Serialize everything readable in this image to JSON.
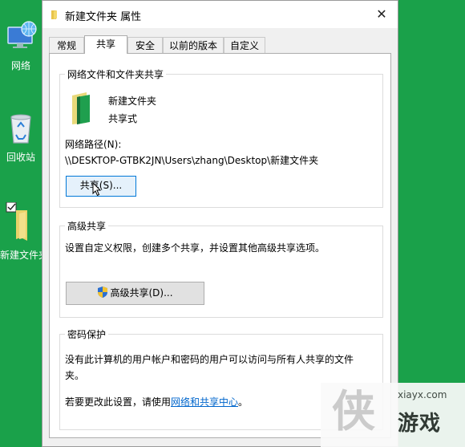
{
  "desktop": {
    "icons": [
      {
        "label": "网络",
        "icon": "network-icon"
      },
      {
        "label": "回收站",
        "icon": "recycle-bin-icon"
      },
      {
        "label": "新建文件夹",
        "icon": "folder-icon"
      }
    ]
  },
  "dialog": {
    "title": "新建文件夹 属性",
    "close_glyph": "✕",
    "tabs": [
      {
        "label": "常规",
        "active": false
      },
      {
        "label": "共享",
        "active": true
      },
      {
        "label": "安全",
        "active": false
      },
      {
        "label": "以前的版本",
        "active": false
      },
      {
        "label": "自定义",
        "active": false
      }
    ],
    "network_sharing": {
      "group_title": "网络文件和文件夹共享",
      "folder_name": "新建文件夹",
      "share_status": "共享式",
      "path_label": "网络路径(N):",
      "path_value": "\\\\DESKTOP-GTBK2JN\\Users\\zhang\\Desktop\\新建文件夹",
      "share_button": "共享(S)..."
    },
    "advanced_sharing": {
      "group_title": "高级共享",
      "description": "设置自定义权限，创建多个共享，并设置其他高级共享选项。",
      "button": "高级共享(D)..."
    },
    "password_protection": {
      "group_title": "密码保护",
      "description_line1": "没有此计算机的用户帐户和密码的用户可以访问与所有人共享的文件",
      "description_line2": "夹。",
      "change_prefix": "若要更改此设置，请使用",
      "link": "网络和共享中心",
      "change_suffix": "。"
    }
  },
  "watermark": {
    "logo": "侠",
    "url": "xiayx.com",
    "name": "游戏"
  }
}
